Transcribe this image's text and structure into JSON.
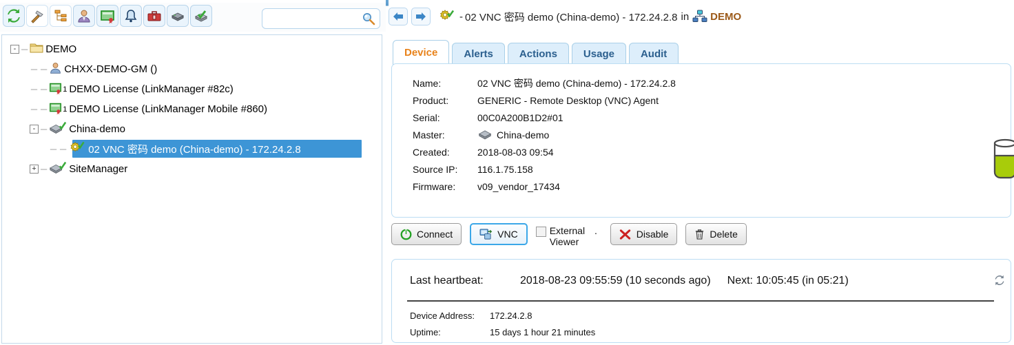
{
  "window": {
    "chrome_bar_color": "#5b9bcd"
  },
  "toolbar": {
    "icons": [
      {
        "name": "refresh-icon",
        "glyph": "refresh"
      },
      {
        "name": "hammer-icon",
        "glyph": "hammer"
      },
      {
        "name": "sitemap-icon",
        "glyph": "sitemap"
      },
      {
        "name": "user-icon",
        "glyph": "user"
      },
      {
        "name": "license-icon",
        "glyph": "license"
      },
      {
        "name": "alert-bell-icon",
        "glyph": "bell"
      },
      {
        "name": "toolbox-icon",
        "glyph": "toolbox"
      },
      {
        "name": "gateway-icon",
        "glyph": "gateway"
      },
      {
        "name": "gateway-ok-icon",
        "glyph": "gateway-ok"
      }
    ],
    "search": {
      "value": "",
      "placeholder": ""
    }
  },
  "tree": {
    "nodes": [
      {
        "label": "DEMO",
        "icon": "folder-icon",
        "depth": 0,
        "expander": "-",
        "selected": false,
        "sup": ""
      },
      {
        "label": "CHXX-DEMO-GM ()",
        "icon": "user-icon",
        "depth": 1,
        "expander": "",
        "selected": false,
        "sup": ""
      },
      {
        "label": "DEMO License (LinkManager #82c)",
        "icon": "license-icon",
        "depth": 1,
        "expander": "",
        "selected": false,
        "sup": "1"
      },
      {
        "label": "DEMO License (LinkManager Mobile #860)",
        "icon": "license-icon",
        "depth": 1,
        "expander": "",
        "selected": false,
        "sup": "1"
      },
      {
        "label": "China-demo",
        "icon": "gateway-ok-icon",
        "depth": 1,
        "expander": "-",
        "selected": false,
        "sup": ""
      },
      {
        "label": "02 VNC 密码 demo (China-demo) - 172.24.2.8",
        "icon": "gear-ok-icon",
        "depth": 2,
        "expander": "",
        "selected": true,
        "sup": ""
      },
      {
        "label": "SiteManager",
        "icon": "gateway-ok-icon",
        "depth": 1,
        "expander": "+",
        "selected": false,
        "sup": ""
      }
    ],
    "selection_color": "#3d95d6"
  },
  "breadcrumb": {
    "back_icon": "arrow-left-icon",
    "forward_icon": "arrow-right-icon",
    "device_icon": "gear-ok-icon",
    "dash": "-",
    "title": "02 VNC 密码 demo (China-demo) - 172.24.2.8",
    "in_word": "in",
    "group_icon": "network-group-icon",
    "group": "DEMO",
    "group_color": "#9c5a19"
  },
  "tabs": [
    {
      "label": "Device",
      "active": true
    },
    {
      "label": "Alerts",
      "active": false
    },
    {
      "label": "Actions",
      "active": false
    },
    {
      "label": "Usage",
      "active": false
    },
    {
      "label": "Audit",
      "active": false
    }
  ],
  "device": {
    "fields": [
      {
        "label": "Name:",
        "value": "02 VNC 密码 demo (China-demo) - 172.24.2.8",
        "icon": ""
      },
      {
        "label": "Product:",
        "value": "GENERIC - Remote Desktop (VNC) Agent",
        "icon": ""
      },
      {
        "label": "Serial:",
        "value": "00C0A200B1D2#01",
        "icon": ""
      },
      {
        "label": "Master:",
        "value": "China-demo",
        "icon": "gateway-icon"
      },
      {
        "label": "Created:",
        "value": "2018-08-03 09:54",
        "icon": ""
      },
      {
        "label": "Source IP:",
        "value": "116.1.75.158",
        "icon": ""
      },
      {
        "label": "Firmware:",
        "value": "v09_vendor_17434",
        "icon": ""
      }
    ]
  },
  "actions": {
    "connect_label": "Connect",
    "connect_icon": "power-icon",
    "vnc_label": "VNC",
    "vnc_icon": "remote-desktop-icon",
    "external_viewer_label_line1": "External",
    "external_viewer_dot": ".",
    "external_viewer_label_line2": "Viewer",
    "external_viewer_checked": false,
    "disable_label": "Disable",
    "disable_icon": "red-x-icon",
    "delete_label": "Delete",
    "delete_icon": "trash-icon"
  },
  "heartbeat": {
    "label": "Last heartbeat:",
    "value": "2018-08-23 09:55:59 (10 seconds ago)",
    "next": "Next: 10:05:45 (in 05:21)",
    "refresh_icon": "refresh-icon",
    "rows": [
      {
        "key": "Device Address:",
        "value": "172.24.2.8"
      },
      {
        "key": "Uptime:",
        "value": "15 days 1 hour 21 minutes"
      }
    ]
  },
  "decoration": {
    "gauge_icon": "green-gauge-icon",
    "gauge_color": "#a8cc0a"
  }
}
